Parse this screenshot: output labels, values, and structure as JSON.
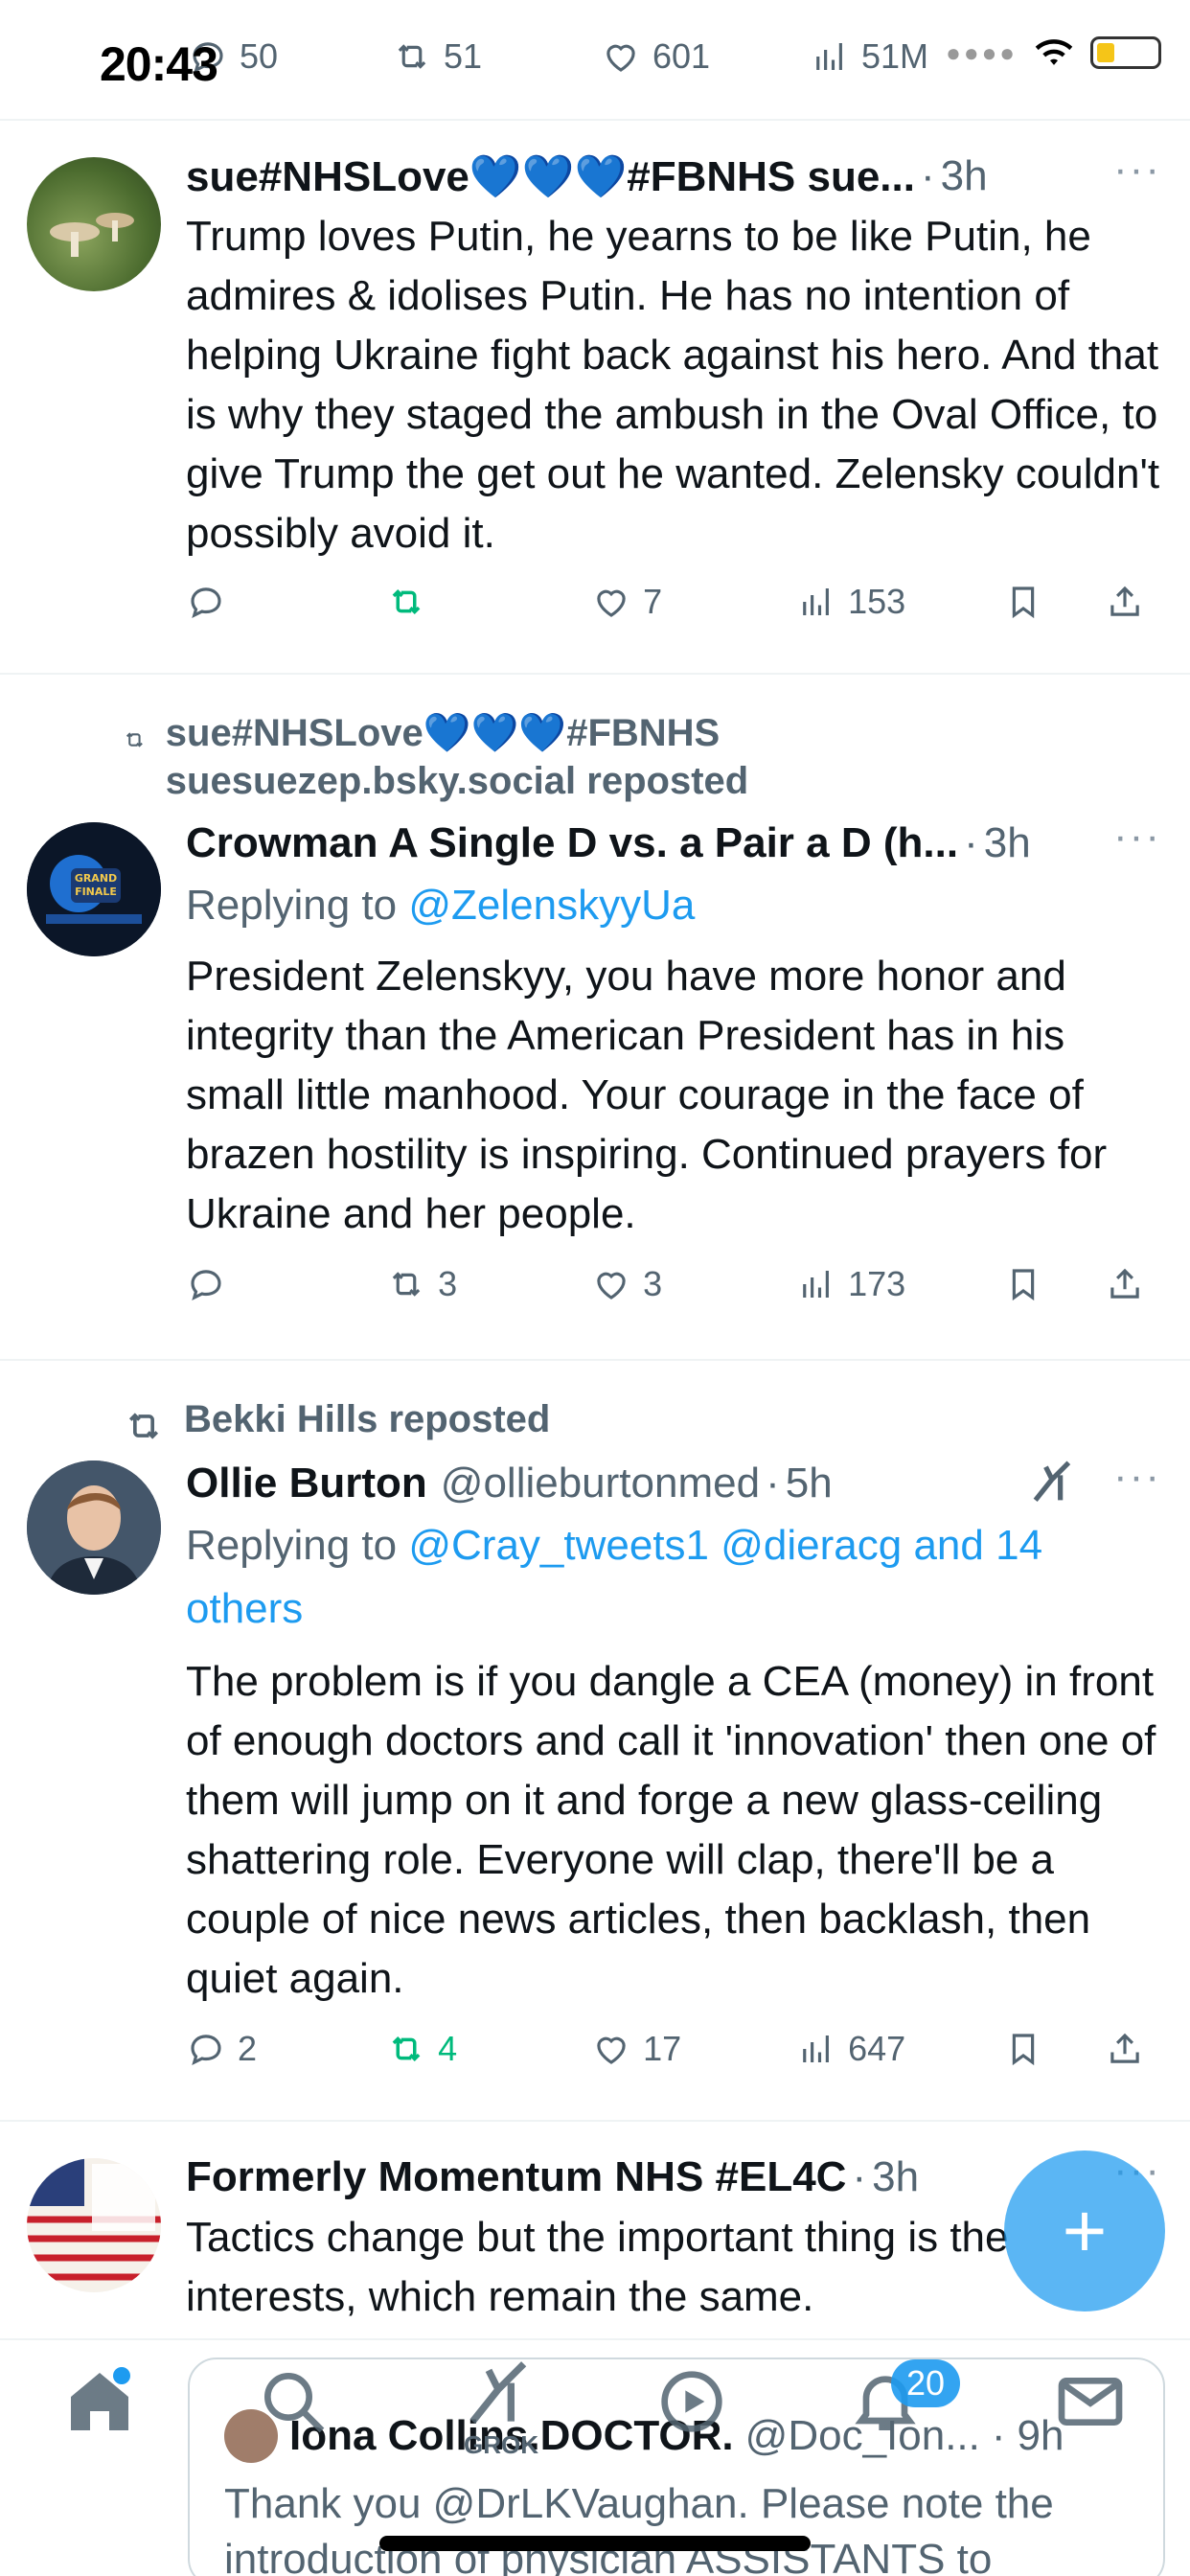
{
  "status_bar": {
    "time": "20:43"
  },
  "top_partial_post": {
    "reply_count": "50",
    "repost_count": "51",
    "like_count": "601",
    "view_count": "51M"
  },
  "posts": [
    {
      "name": "sue#NHSLove💙💙💙#FBNHS sue...",
      "time": "3h",
      "text": "Trump loves Putin, he yearns to be like Putin, he admires & idolises Putin. He has no intention of helping Ukraine fight back against his hero. And that is why they staged the ambush in the Oval Office, to give Trump the get out he wanted.  Zelensky couldn't possibly avoid it.",
      "reply_count": "",
      "repost_count": "",
      "like_count": "7",
      "view_count": "153"
    },
    {
      "repost_by": "sue#NHSLove💙💙💙#FBNHS suesuezep.bsky.social reposted",
      "name": "Crowman A Single D vs. a Pair a D (h...",
      "time": "3h",
      "replying_prefix": "Replying to ",
      "replying_to": "@ZelenskyyUa",
      "text": "President Zelenskyy, you have more honor and integrity than the American President has in his small little manhood. Your courage in the face of brazen hostility is inspiring. Continued prayers for Ukraine and her people.",
      "reply_count": "",
      "repost_count": "3",
      "like_count": "3",
      "view_count": "173"
    },
    {
      "repost_by": "Bekki Hills reposted",
      "name": "Ollie Burton",
      "handle": "@ollieburtonmed",
      "time": "5h",
      "replying_prefix": "Replying to ",
      "replying_to": "@Cray_tweets1 @dieracg and 14 others",
      "text": "The problem is if you dangle a CEA (money) in front of enough doctors and call it 'innovation' then one of them will jump on it and forge a new glass-ceiling shattering role. Everyone will clap, there'll be a couple of nice news articles, then backlash, then quiet again.",
      "reply_count": "2",
      "repost_count": "4",
      "like_count": "17",
      "view_count": "647"
    },
    {
      "name": "Formerly Momentum NHS #EL4C",
      "time": "3h",
      "text": "Tactics change but the important thing is the interests, which remain the same."
    }
  ],
  "preview": {
    "name": "Iona Collins.DOCTOR.",
    "handle": "@Doc_Ion...",
    "time": "9h",
    "text": "Thank you @DrLKVaughan. Please note the introduction of physician ASSISTANTS to"
  },
  "tabbar": {
    "notifications_badge": "20",
    "grok_label": "GROK"
  },
  "icons": [
    "reply-icon",
    "repost-icon",
    "like-icon",
    "views-icon",
    "bookmark-icon",
    "share-icon",
    "more-icon",
    "home-icon",
    "search-icon",
    "grok-icon",
    "spaces-icon",
    "notifications-icon",
    "messages-icon",
    "compose-icon"
  ],
  "colors": {
    "accent": "#1d9bf0",
    "reposted": "#00ba7c",
    "secondary_text": "#536471"
  }
}
